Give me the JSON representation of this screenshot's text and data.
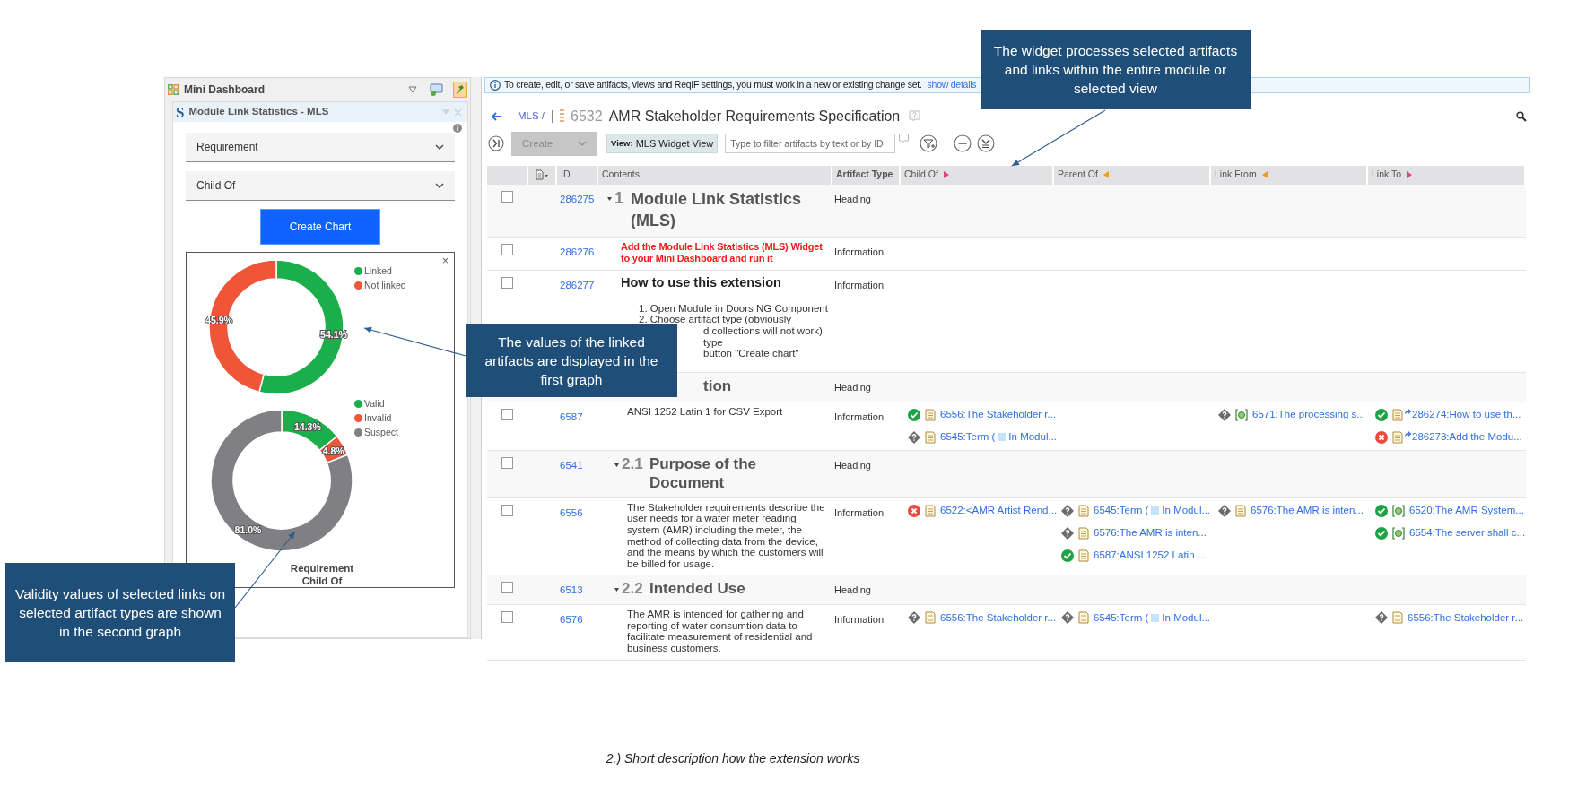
{
  "dashboard": {
    "title": "Mini Dashboard",
    "widget": {
      "logo": "S",
      "title": "Module Link Statistics - MLS",
      "dropdowns": [
        "Requirement",
        "Child Of"
      ],
      "button": "Create Chart",
      "close": "×",
      "charts": [
        {
          "chart_data": {
            "type": "donut",
            "categories": [
              "Linked",
              "Not linked"
            ],
            "values": [
              54.1,
              45.9
            ],
            "value_labels": [
              "54.1%",
              "45.9%"
            ]
          },
          "slices": [
            {
              "color": "#1aaf4b"
            },
            {
              "color": "#f05537"
            }
          ]
        },
        {
          "chart_data": {
            "type": "donut",
            "categories": [
              "Valid",
              "Invalid",
              "Suspect"
            ],
            "values": [
              14.3,
              4.8,
              81.0
            ],
            "value_labels": [
              "14.3%",
              "4.8%",
              "81.0%"
            ]
          },
          "slices": [
            {
              "color": "#1aaf4b"
            },
            {
              "color": "#f05537"
            },
            {
              "color": "#808084"
            }
          ]
        }
      ],
      "chart_caption": [
        "Requirement",
        "Child Of"
      ]
    }
  },
  "notice": {
    "text": "To create, edit, or save artifacts, views and ReqIF settings, you must work in a new or existing change set.",
    "link": "show details"
  },
  "module": {
    "breadcrumb": "MLS /",
    "id": "6532",
    "title": "AMR Stakeholder Requirements Specification"
  },
  "toolbar": {
    "create": {
      "label": "Create",
      "disabled": true
    },
    "view_label": "View:",
    "view_name": "MLS Widget View",
    "filter_placeholder": "Type to filter artifacts by text or by ID"
  },
  "table": {
    "columns": [
      {
        "label": "ID"
      },
      {
        "label": "Contents"
      },
      {
        "label": "Artifact Type"
      },
      {
        "label": "Child Of",
        "kind": "outgoing"
      },
      {
        "label": "Parent Of",
        "kind": "incoming"
      },
      {
        "label": "Link From",
        "kind": "incoming"
      },
      {
        "label": "Link To",
        "kind": "outgoing"
      }
    ],
    "rows": [
      {
        "checked": false,
        "id": "286275",
        "content": {
          "kind": "major_heading",
          "number": "1",
          "title": "Module Link Statistics (MLS)"
        },
        "type": "Heading"
      },
      {
        "checked": false,
        "id": "286276",
        "content": {
          "kind": "note",
          "text": "Add the Module Link Statistics (MLS) Widget to your Mini Dashboard and run it"
        },
        "type": "Information"
      },
      {
        "checked": false,
        "id": "286277",
        "content": {
          "kind": "section",
          "title": "How to use this extension",
          "lines": [
            {
              "kind": "whole",
              "text": "1. Open Module in Doors NG Component"
            },
            {
              "kind": "whole",
              "text": "2. Choose artifact type (obviously"
            },
            {
              "kind": "partial",
              "text": "d collections will not work)"
            },
            {
              "kind": "partial",
              "text": "type"
            },
            {
              "kind": "partial",
              "text": "button \"Create chart\""
            }
          ]
        },
        "type": "Information"
      },
      {
        "content": {
          "kind": "covered_heading",
          "text": "tion"
        },
        "type": "Heading"
      },
      {
        "checked": false,
        "id": "6587",
        "content": {
          "kind": "text",
          "text": "ANSI 1252 Latin 1 for CSV Export"
        },
        "type": "Information",
        "child_of": [
          {
            "kind": "valid",
            "model": false,
            "text": "6556:The Stakeholder r..."
          },
          {
            "kind": "suspect",
            "model": false,
            "text": "6545:Term (",
            "text_after": "In Modul..."
          }
        ],
        "link_from": [
          {
            "kind": "suspect",
            "model": true,
            "text": "6571:The processing s..."
          }
        ],
        "link_to": [
          {
            "kind": "valid",
            "model": false,
            "external": true,
            "text": "286274:How to use th..."
          },
          {
            "kind": "invalid",
            "model": false,
            "external": true,
            "text": "286273:Add the Modu..."
          }
        ]
      },
      {
        "checked": false,
        "id": "6541",
        "content": {
          "kind": "minor_heading",
          "number": "2.1",
          "title": "Purpose of the Document"
        },
        "type": "Heading"
      },
      {
        "checked": false,
        "id": "6556",
        "content": {
          "kind": "text",
          "text": "The Stakeholder requirements describe the user needs for a water meter reading system (AMR) including the meter, the method of collecting data from the device, and the means by which the customers will be billed for usage."
        },
        "type": "Information",
        "child_of": [
          {
            "kind": "invalid",
            "model": false,
            "text": "6522:<AMR Artist Rend..."
          }
        ],
        "parent_of": [
          {
            "kind": "suspect",
            "model": false,
            "text": "6545:Term (",
            "text_after": "In Modul..."
          },
          {
            "kind": "suspect",
            "model": false,
            "text": "6576:The AMR is inten..."
          },
          {
            "kind": "valid",
            "model": false,
            "text": "6587:ANSI 1252 Latin ..."
          }
        ],
        "link_from": [
          {
            "kind": "suspect",
            "model": false,
            "text": "6576:The AMR is inten..."
          }
        ],
        "link_to": [
          {
            "kind": "valid",
            "model": true,
            "text": "6520:The AMR System..."
          },
          {
            "kind": "valid",
            "model": true,
            "text": "6554:The server shall c..."
          }
        ]
      },
      {
        "checked": false,
        "id": "6513",
        "content": {
          "kind": "minor_heading",
          "number": "2.2",
          "title": "Intended Use"
        },
        "type": "Heading"
      },
      {
        "checked": false,
        "id": "6576",
        "content": {
          "kind": "text",
          "text": "The AMR is intended for gathering and reporting of water consumtion data to facilitate measurement of residential and business customers."
        },
        "type": "Information",
        "child_of": [
          {
            "kind": "suspect",
            "model": false,
            "text": "6556:The Stakeholder r..."
          }
        ],
        "parent_of": [
          {
            "kind": "suspect",
            "model": false,
            "text": "6545:Term (",
            "text_after": "In Modul..."
          }
        ],
        "link_to": [
          {
            "kind": "suspect",
            "model": false,
            "text": "6556:The Stakeholder r..."
          }
        ]
      }
    ]
  },
  "callouts": [
    {
      "text": "The widget processes selected artifacts and links within the entire module or selected view"
    },
    {
      "text": "The values of the linked artifacts are displayed in the first graph"
    },
    {
      "text": "Validity values of selected links on selected artifact types are shown in the second graph"
    }
  ],
  "caption": "2.) Short description how the extension works"
}
